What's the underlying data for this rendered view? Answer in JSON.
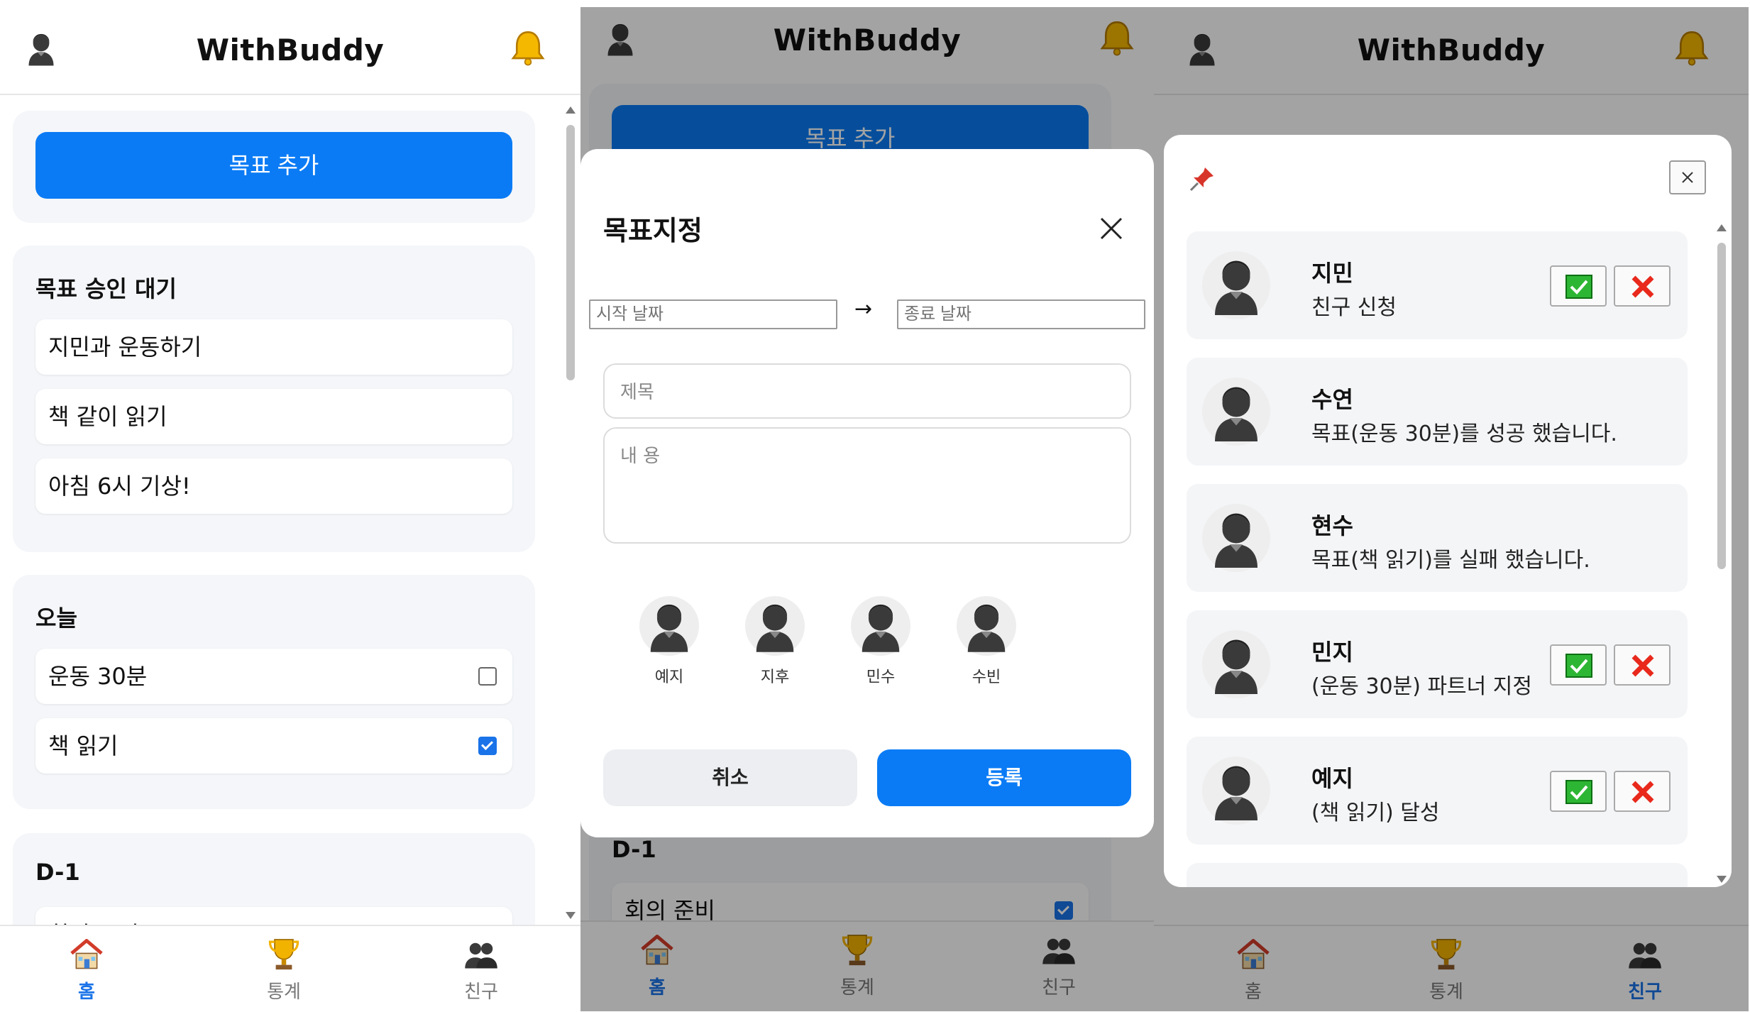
{
  "app": {
    "title": "WithBuddy"
  },
  "home": {
    "add_goal": "목표 추가",
    "pending": {
      "title": "목표 승인 대기",
      "items": [
        "지민과 운동하기",
        "책 같이 읽기",
        "아침 6시 기상!"
      ]
    },
    "today": {
      "title": "오늘",
      "items": [
        {
          "label": "운동 30분",
          "checked": false
        },
        {
          "label": "책 읽기",
          "checked": true
        }
      ]
    },
    "dminus": {
      "title": "D-1",
      "items": [
        "회의 준비"
      ]
    }
  },
  "nav": {
    "home": "홈",
    "stats": "통계",
    "friends": "친구"
  },
  "goal_dialog": {
    "title": "목표지정",
    "start_placeholder": "시작 날짜",
    "arrow": "→",
    "end_placeholder": "종료 날짜",
    "title_placeholder": "제목",
    "content_placeholder": "내 용",
    "friends": [
      "예지",
      "지후",
      "민수",
      "수빈"
    ],
    "cancel": "취소",
    "submit": "등록"
  },
  "notifications": [
    {
      "name": "지민",
      "message": "친구 신청",
      "actions": true
    },
    {
      "name": "수연",
      "message": "목표(운동 30분)를 성공 했습니다.",
      "actions": false
    },
    {
      "name": "현수",
      "message": "목표(책 읽기)를 실패 했습니다.",
      "actions": false
    },
    {
      "name": "민지",
      "message": "(운동 30분) 파트너 지정",
      "actions": true
    },
    {
      "name": "예지",
      "message": "(책 읽기) 달성",
      "actions": true
    }
  ],
  "colors": {
    "accent": "#0a7bf5",
    "card_bg": "#f4f6f9",
    "active_nav": "#1a73e8",
    "accept": "#2db634",
    "reject": "#e8291c"
  }
}
